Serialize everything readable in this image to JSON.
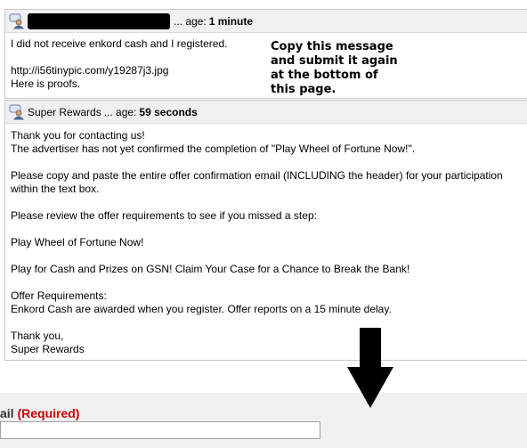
{
  "messages": [
    {
      "author": "",
      "age_label": "... age:",
      "age": "1 minute",
      "body": "I did not receive enkord cash and I registered.\n\nhttp://i56tinypic.com/y19287j3.jpg\nHere is proofs."
    },
    {
      "author": "Super Rewards",
      "age_label": "... age:",
      "age": "59 seconds",
      "body": "Thank you for contacting us!\nThe advertiser has not yet confirmed the completion of \"Play Wheel of Fortune Now!\".\n\nPlease copy and paste the entire offer confirmation email (INCLUDING the header) for your participation within the text box.\n\nPlease review the offer requirements to see if you missed a step:\n\nPlay Wheel of Fortune Now!\n\nPlay for Cash and Prizes on GSN! Claim Your Case for a Chance to Break the Bank!\n\nOffer Requirements:\nEnkord Cash are awarded when you register. Offer reports on a 15 minute delay.\n\nThank you,\nSuper Rewards"
    }
  ],
  "annotation": "Copy this message\nand submit it again\nat the bottom of\nthis page.",
  "form": {
    "email_label": "ail",
    "email_required": "(Required)",
    "email_value": ""
  },
  "icons": {
    "message_icon": "user-comment-icon",
    "arrow": "arrow-down-icon"
  }
}
